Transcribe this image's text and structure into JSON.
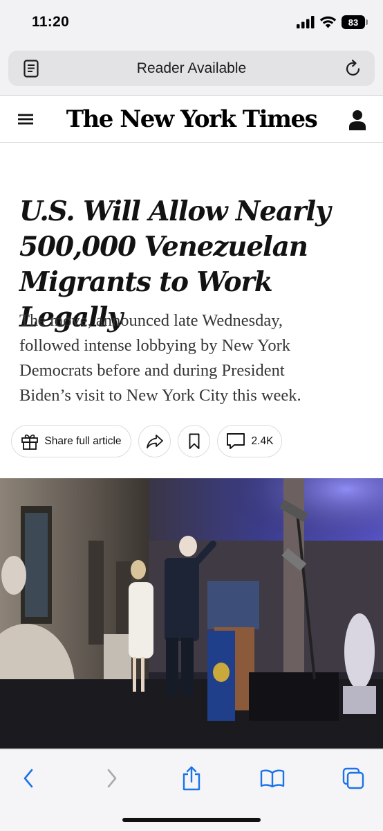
{
  "status_bar": {
    "time": "11:20",
    "battery": "83",
    "icons": [
      "cellular-signal-icon",
      "wifi-icon",
      "battery-icon"
    ]
  },
  "address_bar": {
    "text": "Reader Available",
    "left_icon": "reader-view-icon",
    "right_icon": "reload-icon"
  },
  "nyt_header": {
    "masthead": "The New York Times",
    "left_icon": "menu-icon",
    "right_icon": "account-icon"
  },
  "article": {
    "headline_lines": [
      "U.S. Will Allow Nearly",
      "500,000 Venezuelan",
      "Migrants to Work Legally"
    ],
    "summary_lines": [
      "The move, announced late Wednesday,",
      "followed intense lobbying by New York",
      "Democrats before and during President",
      "Biden’s visit to New York City this week."
    ],
    "actions": {
      "share_label": "Share full article",
      "comment_count": "2.4K"
    }
  },
  "toolbar": {
    "buttons": [
      "back-icon",
      "forward-icon",
      "share-icon",
      "bookmarks-icon",
      "tabs-icon"
    ],
    "accent": "#1a73e8"
  },
  "colors": {
    "browser_chrome": "#f2f2f4",
    "text": "#121212",
    "summary": "#363636"
  }
}
